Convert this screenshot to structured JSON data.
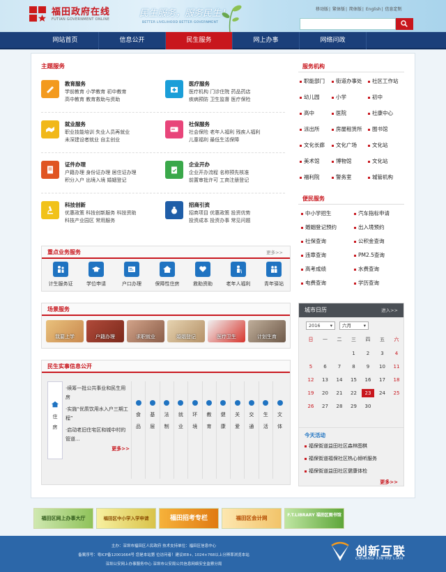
{
  "header": {
    "logo_title": "福田政府在线",
    "logo_subtitle": "FUTIAN GOVERNMENT ONLINE",
    "slogan": "民生服务，服务民生！",
    "slogan_sub": "BETTER LIVELIHOOD BETTER GOVERNMENT",
    "toplinks": [
      "移动版",
      "繁体版",
      "简体版",
      "English",
      "信息定制"
    ],
    "search_placeholder": ""
  },
  "nav": [
    "网站首页",
    "信息公开",
    "民生服务",
    "网上办事",
    "网络问政"
  ],
  "nav_active": 2,
  "theme": {
    "heading": "主题服务",
    "items": [
      {
        "title": "教育服务",
        "l1": "学前教育  小学教育  初中教育",
        "l2": "高中教育  教育救助与资助",
        "color": "#f39a1e"
      },
      {
        "title": "医疗服务",
        "l1": "医疗机构  门诊住院  药品药店",
        "l2": "疾病预防  卫生监督  医疗保险",
        "color": "#1a9ed8"
      },
      {
        "title": "就业服务",
        "l1": "职业技能培训  失业人员再就业",
        "l2": "未深建设者就业  自主创业",
        "color": "#f1b81a"
      },
      {
        "title": "社保服务",
        "l1": "社会保险  老年人福利  残疾人福利",
        "l2": "儿童福利  最低生活保障",
        "color": "#e8457a"
      },
      {
        "title": "证件办理",
        "l1": "户籍办理  身份证办理  居住证办理",
        "l2": "积分入户  出境入境  婚姻登记",
        "color": "#e05522"
      },
      {
        "title": "企业开办",
        "l1": "企业开办流程  名称预先核准",
        "l2": "前置审批许可  工商注册登记",
        "color": "#3aa84a"
      },
      {
        "title": "科技创新",
        "l1": "优惠政策  科技创新服务  科技资助",
        "l2": "科技产业园区  常用服务",
        "color": "#f1c21a"
      },
      {
        "title": "招商引资",
        "l1": "招商项目  优惠政策  投资优势",
        "l2": "投资成本  投资办事  常见问题",
        "color": "#1f5ea8"
      }
    ]
  },
  "key_business": {
    "heading": "重点业务服务",
    "more": "更多>>",
    "items": [
      "计生服务证",
      "学位申请",
      "户口办理",
      "保障性住房",
      "救助资助",
      "老年人福利",
      "青年驿站"
    ]
  },
  "scenes": {
    "heading": "场景服务",
    "items": [
      "我要上学",
      "户籍办理",
      "求职就业",
      "婚姻登记",
      "医疗卫生",
      "计划生育"
    ]
  },
  "practical": {
    "heading": "民生实事信息公开",
    "tab_label": "住房",
    "news": [
      "·续筹一批公共事业和民生用房",
      "·实施“优质饮用水入户三期工程”",
      "·启动老旧住宅区和城中村的管道..."
    ],
    "more": "更多>>",
    "categories": [
      "食品",
      "基层",
      "法制",
      "就业",
      "环境",
      "教育",
      "健康",
      "关爱",
      "交通",
      "生活",
      "文体"
    ]
  },
  "orgs": {
    "heading": "服务机构",
    "items": [
      "职能部门",
      "街道办事处",
      "社区工作站",
      "幼儿园",
      "小学",
      "初中",
      "高中",
      "医院",
      "社康中心",
      "派出所",
      "房屋租赁所",
      "图书馆",
      "文化长廊",
      "文化广场",
      "文化站",
      "美术馆",
      "博物馆",
      "文化站",
      "福利院",
      "警务室",
      "城管机构"
    ]
  },
  "life": {
    "heading": "便民服务",
    "items": [
      "中小学招生",
      "汽车指标申请",
      "婚姻登记预约",
      "出入境预约",
      "社保查询",
      "公积金查询",
      "违章查询",
      "PM2.5查询",
      "高考成绩",
      "水费查询",
      "电费查询",
      "学历查询"
    ]
  },
  "calendar": {
    "heading": "城市日历",
    "more": "进入>>",
    "year": "2016",
    "month": "六月",
    "weekdays": [
      "日",
      "一",
      "二",
      "三",
      "四",
      "五",
      "六"
    ],
    "days": [
      [
        "",
        "",
        "",
        "1",
        "2",
        "3",
        "4"
      ],
      [
        "5",
        "6",
        "7",
        "8",
        "9",
        "10",
        "11"
      ],
      [
        "12",
        "13",
        "14",
        "15",
        "16",
        "17",
        "18"
      ],
      [
        "19",
        "20",
        "21",
        "22",
        "23",
        "24",
        "25"
      ],
      [
        "26",
        "27",
        "28",
        "29",
        "30",
        "",
        ""
      ]
    ],
    "today": "23",
    "activity_heading": "今天活动",
    "activities": [
      "福保街道益田社区森林图棋",
      "福保街道福保社区热心倾听服务",
      "福保街道益田社区健康体检"
    ],
    "more2": "更多>>"
  },
  "banners": [
    "福田区网上办事大厅",
    "福田区中小学入学申请",
    "福田招考专栏",
    "福田区会计网",
    "F.T.LIBRARY 福田区图书馆"
  ],
  "footer": {
    "line1": "主办：深圳市福田区人民政府  技术支持单位：福田区信息中心",
    "line2": "备案序号：粤ICP备12001664号  您是本站第   位访问者！建议IE8+, 1024×768以上分辨率浏览本站",
    "line3": "深圳公安网上办事服务中心  深圳市公安局公共信息网络安全监察分局",
    "brand": "创新互联",
    "brand_sub": "CHUANG XIN HU LIAN"
  },
  "colors": {
    "brand_red": "#c8161d",
    "nav_blue": "#1b3f7a",
    "footer_blue": "#2c67a9"
  }
}
